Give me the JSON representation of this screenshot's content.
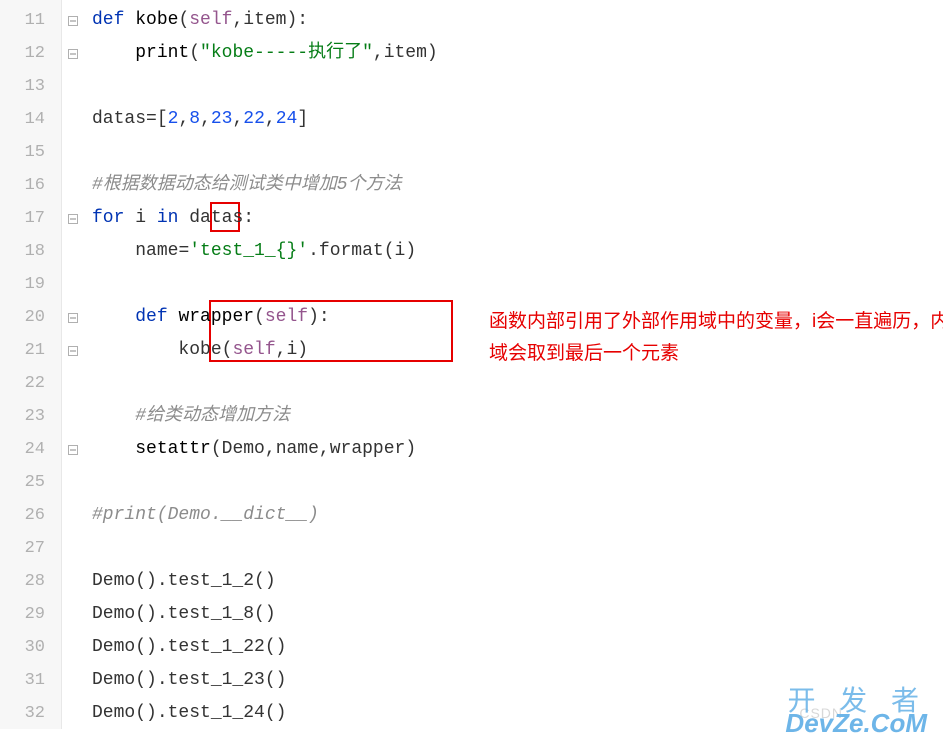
{
  "lines": [
    {
      "num": "11",
      "fold": "open-top",
      "tokens": [
        {
          "t": "def ",
          "c": "def-kw"
        },
        {
          "t": "kobe",
          "c": "func-name"
        },
        {
          "t": "(",
          "c": "paren"
        },
        {
          "t": "self",
          "c": "self"
        },
        {
          "t": ",",
          "c": "op"
        },
        {
          "t": "item",
          "c": "ident"
        },
        {
          "t": "):",
          "c": "paren"
        }
      ],
      "indent": 0
    },
    {
      "num": "12",
      "fold": "close",
      "tokens": [
        {
          "t": "    ",
          "c": ""
        },
        {
          "t": "print",
          "c": "builtin"
        },
        {
          "t": "(",
          "c": "paren"
        },
        {
          "t": "\"kobe-----执行了\"",
          "c": "str"
        },
        {
          "t": ",",
          "c": "op"
        },
        {
          "t": "item",
          "c": "ident"
        },
        {
          "t": ")",
          "c": "paren"
        }
      ],
      "indent": 0
    },
    {
      "num": "13",
      "fold": "",
      "tokens": [],
      "indent": 0
    },
    {
      "num": "14",
      "fold": "",
      "tokens": [
        {
          "t": "datas",
          "c": "ident"
        },
        {
          "t": "=[",
          "c": "op"
        },
        {
          "t": "2",
          "c": "num"
        },
        {
          "t": ",",
          "c": "op"
        },
        {
          "t": "8",
          "c": "num"
        },
        {
          "t": ",",
          "c": "op"
        },
        {
          "t": "23",
          "c": "num"
        },
        {
          "t": ",",
          "c": "op"
        },
        {
          "t": "22",
          "c": "num"
        },
        {
          "t": ",",
          "c": "op"
        },
        {
          "t": "24",
          "c": "num"
        },
        {
          "t": "]",
          "c": "op"
        }
      ],
      "indent": 0
    },
    {
      "num": "15",
      "fold": "",
      "tokens": [],
      "indent": 0
    },
    {
      "num": "16",
      "fold": "",
      "tokens": [
        {
          "t": "#根据数据动态给测试类中增加5个方法",
          "c": "comment"
        }
      ],
      "indent": 0
    },
    {
      "num": "17",
      "fold": "open-top",
      "tokens": [
        {
          "t": "for ",
          "c": "kw"
        },
        {
          "t": "i",
          "c": "ident"
        },
        {
          "t": " in ",
          "c": "kw"
        },
        {
          "t": "datas",
          "c": "ident"
        },
        {
          "t": ":",
          "c": "op"
        }
      ],
      "indent": 0
    },
    {
      "num": "18",
      "fold": "",
      "tokens": [
        {
          "t": "    ",
          "c": ""
        },
        {
          "t": "name",
          "c": "ident"
        },
        {
          "t": "=",
          "c": "op"
        },
        {
          "t": "'test_1_{}'",
          "c": "str"
        },
        {
          "t": ".",
          "c": "op"
        },
        {
          "t": "format",
          "c": "ident"
        },
        {
          "t": "(",
          "c": "paren"
        },
        {
          "t": "i",
          "c": "ident"
        },
        {
          "t": ")",
          "c": "paren"
        }
      ],
      "indent": 0
    },
    {
      "num": "19",
      "fold": "",
      "tokens": [],
      "indent": 0
    },
    {
      "num": "20",
      "fold": "open-top",
      "tokens": [
        {
          "t": "    ",
          "c": ""
        },
        {
          "t": "def ",
          "c": "def-kw"
        },
        {
          "t": "wrapper",
          "c": "func-name"
        },
        {
          "t": "(",
          "c": "paren"
        },
        {
          "t": "self",
          "c": "self"
        },
        {
          "t": "):",
          "c": "paren"
        }
      ],
      "indent": 0
    },
    {
      "num": "21",
      "fold": "close",
      "tokens": [
        {
          "t": "        ",
          "c": ""
        },
        {
          "t": "kobe",
          "c": "ident"
        },
        {
          "t": "(",
          "c": "paren"
        },
        {
          "t": "self",
          "c": "self"
        },
        {
          "t": ",",
          "c": "op"
        },
        {
          "t": "i",
          "c": "ident"
        },
        {
          "t": ")",
          "c": "paren"
        }
      ],
      "indent": 0
    },
    {
      "num": "22",
      "fold": "",
      "tokens": [],
      "indent": 0
    },
    {
      "num": "23",
      "fold": "",
      "tokens": [
        {
          "t": "    ",
          "c": ""
        },
        {
          "t": "#给类动态增加方法",
          "c": "comment"
        }
      ],
      "indent": 0
    },
    {
      "num": "24",
      "fold": "close",
      "tokens": [
        {
          "t": "    ",
          "c": ""
        },
        {
          "t": "setattr",
          "c": "builtin"
        },
        {
          "t": "(",
          "c": "paren"
        },
        {
          "t": "Demo",
          "c": "ident"
        },
        {
          "t": ",",
          "c": "op"
        },
        {
          "t": "name",
          "c": "ident"
        },
        {
          "t": ",",
          "c": "op"
        },
        {
          "t": "wrapper",
          "c": "ident"
        },
        {
          "t": ")",
          "c": "paren"
        }
      ],
      "indent": 0
    },
    {
      "num": "25",
      "fold": "",
      "tokens": [],
      "indent": 0
    },
    {
      "num": "26",
      "fold": "",
      "tokens": [
        {
          "t": "#print(Demo.__dict__)",
          "c": "comment"
        }
      ],
      "indent": 0
    },
    {
      "num": "27",
      "fold": "",
      "tokens": [],
      "indent": 0
    },
    {
      "num": "28",
      "fold": "",
      "tokens": [
        {
          "t": "Demo",
          "c": "ident"
        },
        {
          "t": "().",
          "c": "op"
        },
        {
          "t": "test_1_2",
          "c": "ident"
        },
        {
          "t": "()",
          "c": "paren"
        }
      ],
      "indent": 0
    },
    {
      "num": "29",
      "fold": "",
      "tokens": [
        {
          "t": "Demo",
          "c": "ident"
        },
        {
          "t": "().",
          "c": "op"
        },
        {
          "t": "test_1_8",
          "c": "ident"
        },
        {
          "t": "()",
          "c": "paren"
        }
      ],
      "indent": 0
    },
    {
      "num": "30",
      "fold": "",
      "tokens": [
        {
          "t": "Demo",
          "c": "ident"
        },
        {
          "t": "().",
          "c": "op"
        },
        {
          "t": "test_1_22",
          "c": "ident"
        },
        {
          "t": "()",
          "c": "paren"
        }
      ],
      "indent": 0
    },
    {
      "num": "31",
      "fold": "",
      "tokens": [
        {
          "t": "Demo",
          "c": "ident"
        },
        {
          "t": "().",
          "c": "op"
        },
        {
          "t": "test_1_23",
          "c": "ident"
        },
        {
          "t": "()",
          "c": "paren"
        }
      ],
      "indent": 0
    },
    {
      "num": "32",
      "fold": "",
      "tokens": [
        {
          "t": "Demo",
          "c": "ident"
        },
        {
          "t": "().",
          "c": "op"
        },
        {
          "t": "test_1_24",
          "c": "ident"
        },
        {
          "t": "()",
          "c": "paren"
        }
      ],
      "indent": 0
    }
  ],
  "annotation": "函数内部引用了外部作用域中的变量，i会一直遍历，内部作用域会取到最后一个元素",
  "watermark_top": "开 发 者",
  "watermark_bottom": "DevZe.CoM",
  "watermark_csdn": "CSDN"
}
